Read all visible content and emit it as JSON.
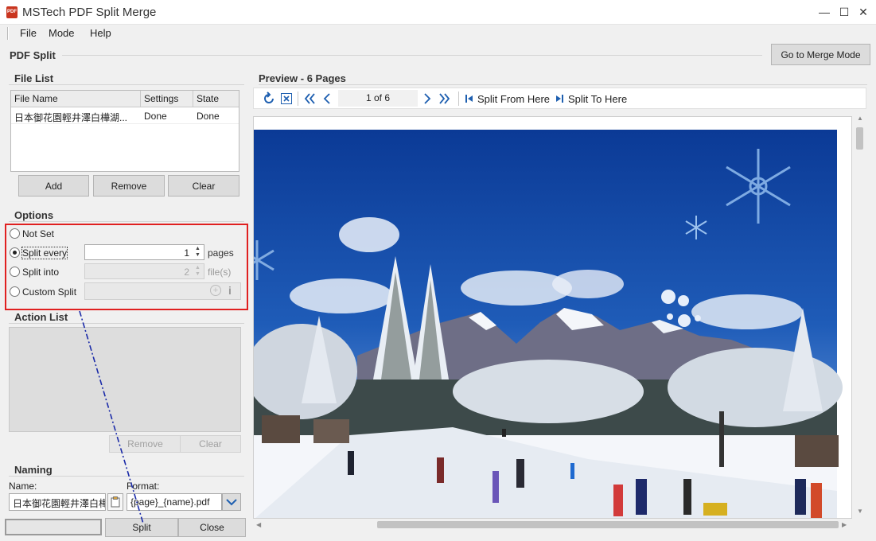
{
  "app": {
    "title": "MSTech PDF Split Merge",
    "icon_text": "PDF"
  },
  "window_controls": {
    "minimize": "—",
    "maximize": "☐",
    "close": "✕"
  },
  "menu": [
    "File",
    "Mode",
    "Help"
  ],
  "header": {
    "title": "PDF Split",
    "merge_button": "Go to Merge Mode"
  },
  "file_list": {
    "title": "File List",
    "columns": [
      "File Name",
      "Settings",
      "State"
    ],
    "rows": [
      {
        "name": "日本御花園輕井澤白樺湖...",
        "settings": "Done",
        "state": "Done"
      }
    ],
    "buttons": {
      "add": "Add",
      "remove": "Remove",
      "clear": "Clear"
    }
  },
  "options": {
    "title": "Options",
    "not_set": "Not Set",
    "split_every": "Split every",
    "split_every_value": "1",
    "split_every_unit": "pages",
    "split_into": "Split into",
    "split_into_value": "2",
    "split_into_unit": "file(s)",
    "custom_split": "Custom Split",
    "selected": "split_every"
  },
  "action_list": {
    "title": "Action List",
    "remove": "Remove",
    "clear": "Clear"
  },
  "naming": {
    "title": "Naming",
    "name_label": "Name:",
    "name_value": "日本御花園輕井澤白樺",
    "format_label": "Format:",
    "format_value": "{page}_{name}.pdf"
  },
  "bottom": {
    "split": "Split",
    "close": "Close"
  },
  "preview": {
    "title": "Preview - 6 Pages",
    "page_indicator": "1 of 6",
    "split_from_here": "Split From Here",
    "split_to_here": "Split To Here"
  },
  "colors": {
    "highlight": "#e02020",
    "toolbar_icon": "#1e5fb0",
    "sky": "#1c4fa8",
    "snow": "#f4f6fa"
  }
}
